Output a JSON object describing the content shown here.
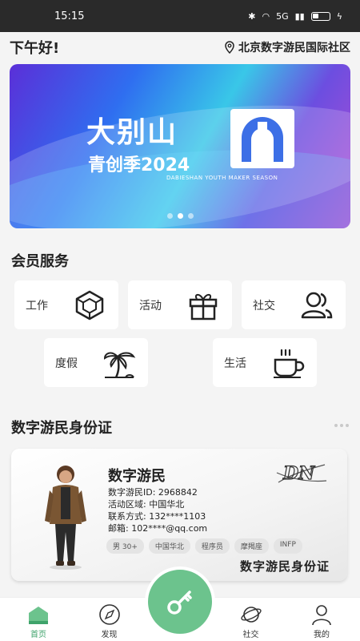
{
  "status_bar": {
    "time": "15:15",
    "network": "5G"
  },
  "header": {
    "greeting": "下午好!",
    "location": "北京数字游民国际社区"
  },
  "banner": {
    "title": "大别山",
    "subtitle": "青创季2024",
    "tagline": "DABIESHAN YOUTH MAKER SEASON",
    "slide_count": 3,
    "active_slide": 1
  },
  "member_services": {
    "title": "会员服务",
    "items": [
      {
        "label": "工作",
        "icon": "box-icon"
      },
      {
        "label": "活动",
        "icon": "gift-icon"
      },
      {
        "label": "社交",
        "icon": "people-icon"
      },
      {
        "label": "度假",
        "icon": "palm-tree-icon"
      },
      {
        "label": "生活",
        "icon": "coffee-cup-icon"
      }
    ]
  },
  "identity": {
    "section_title": "数字游民身份证",
    "name": "数字游民",
    "lines": [
      "数字游民ID: 2968842",
      "活动区域: 中国华北",
      "联系方式: 132****1103",
      "邮箱: 102****@qq.com"
    ],
    "tags": [
      "男 30+",
      "中国华北",
      "程序员",
      "摩羯座",
      "INFP"
    ],
    "card_label": "数字游民身份证",
    "logo_text": "DN"
  },
  "nav": {
    "items": [
      {
        "label": "首页",
        "icon": "home-icon",
        "active": true
      },
      {
        "label": "发现",
        "icon": "compass-icon",
        "active": false
      },
      {
        "label": "社交",
        "icon": "planet-icon",
        "active": false
      },
      {
        "label": "我的",
        "icon": "user-icon",
        "active": false
      }
    ],
    "center_icon": "key-icon"
  },
  "colors": {
    "accent": "#6cc38d",
    "active_nav": "#3fa36b",
    "status_bar": "#2a2a2a"
  }
}
